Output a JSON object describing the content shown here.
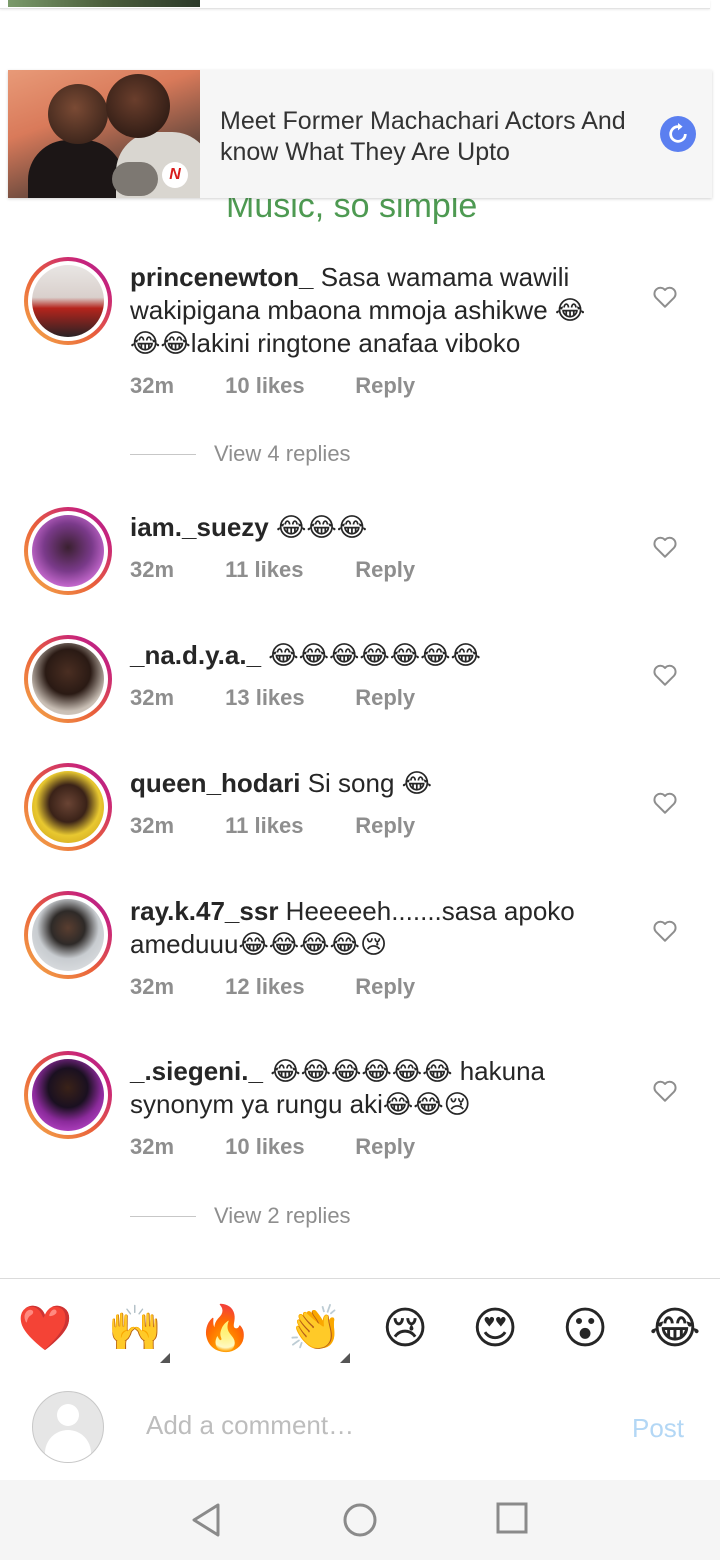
{
  "ad": {
    "text": "Meet Former Machachari Actors And know What They Are Upto",
    "badge": "N",
    "behind_text": "Music, so simple"
  },
  "comments": [
    {
      "username": "princenewton_",
      "text": "Sasa wamama wawili wakipigana mbaona mmoja ashikwe 😂😂😂lakini ringtone anafaa viboko",
      "time": "32m",
      "likes": "10 likes",
      "reply": "Reply",
      "view_replies": "View 4 replies"
    },
    {
      "username": "iam._suezy",
      "text": "😂😂😂",
      "time": "32m",
      "likes": "11 likes",
      "reply": "Reply"
    },
    {
      "username": "_na.d.y.a._",
      "text": "😂😂😂😂😂😂😂",
      "time": "32m",
      "likes": "13 likes",
      "reply": "Reply"
    },
    {
      "username": "queen_hodari",
      "text": "Si song 😂",
      "time": "32m",
      "likes": "11 likes",
      "reply": "Reply"
    },
    {
      "username": "ray.k.47_ssr",
      "text": "Heeeeeh.......sasa apoko ameduuu😂😂😂😂😢",
      "time": "32m",
      "likes": "12 likes",
      "reply": "Reply"
    },
    {
      "username": "_.siegeni._",
      "text": "😂😂😂😂😂😂 hakuna synonym ya rungu aki😂😂😢",
      "time": "32m",
      "likes": "10 likes",
      "reply": "Reply",
      "view_replies": "View 2 replies"
    }
  ],
  "emoji_bar": [
    "❤️",
    "🙌",
    "🔥",
    "👏",
    "😢",
    "😍",
    "😮",
    "😂"
  ],
  "input": {
    "placeholder": "Add a comment…",
    "post_label": "Post"
  },
  "colors": {
    "accent": "#3897f0",
    "post_disabled": "#b3d7f5",
    "ad_refresh": "#5b7ff0",
    "ad_behind_text": "#4e9a52"
  },
  "icons": {
    "heart": "heart-outline-icon",
    "refresh": "refresh-icon",
    "nav": [
      "back-triangle-icon",
      "home-circle-icon",
      "recents-square-icon"
    ]
  }
}
